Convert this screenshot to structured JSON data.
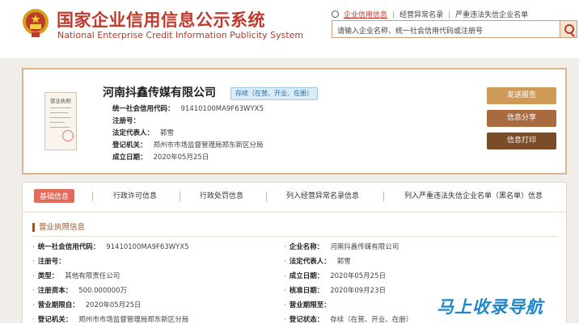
{
  "header": {
    "title_cn": "国家企业信用信息公示系统",
    "title_en": "National Enterprise Credit Information Publicity System",
    "search_tabs": [
      "企业信用信息",
      "经营异常名录",
      "严重违法失信企业名单"
    ],
    "search_placeholder": "请输入企业名称、统一社会信用代码或注册号"
  },
  "company": {
    "name": "河南抖鑫传媒有限公司",
    "status_badge": "存续（在营、开业、在册）",
    "license_label": "营业执照",
    "fields": [
      {
        "label": "统一社会信用代码：",
        "value": "91410100MA9F63WYX5"
      },
      {
        "label": "注册号：",
        "value": ""
      },
      {
        "label": "法定代表人：",
        "value": "郭雪"
      },
      {
        "label": "登记机关：",
        "value": "郑州市市场监督管理局郑东新区分局"
      },
      {
        "label": "成立日期：",
        "value": "2020年05月25日"
      }
    ],
    "buttons": [
      "发送报告",
      "信息分享",
      "信息打印"
    ]
  },
  "tabs": [
    "基础信息",
    "行政许可信息",
    "行政处罚信息",
    "列入经营异常名录信息",
    "列入严重违法失信企业名单（黑名单）信息"
  ],
  "section_title": "营业执照信息",
  "details_left": [
    {
      "label": "统一社会信用代码：",
      "value": "91410100MA9F63WYX5"
    },
    {
      "label": "注册号：",
      "value": ""
    },
    {
      "label": "类型：",
      "value": "其他有限责任公司"
    },
    {
      "label": "注册资本：",
      "value": "500.000000万"
    },
    {
      "label": "营业期限自：",
      "value": "2020年05月25日"
    },
    {
      "label": "登记机关：",
      "value": "郑州市市场监督管理局郑东新区分局"
    }
  ],
  "details_right": [
    {
      "label": "企业名称：",
      "value": "河南抖鑫传媒有限公司"
    },
    {
      "label": "法定代表人：",
      "value": "郭雪"
    },
    {
      "label": "成立日期：",
      "value": "2020年05月25日"
    },
    {
      "label": "核准日期：",
      "value": "2020年09月23日"
    },
    {
      "label": "营业期限至：",
      "value": ""
    },
    {
      "label": "登记状态：",
      "value": "存续（在营、开业、在册）"
    }
  ],
  "watermark": "马上收录导航"
}
